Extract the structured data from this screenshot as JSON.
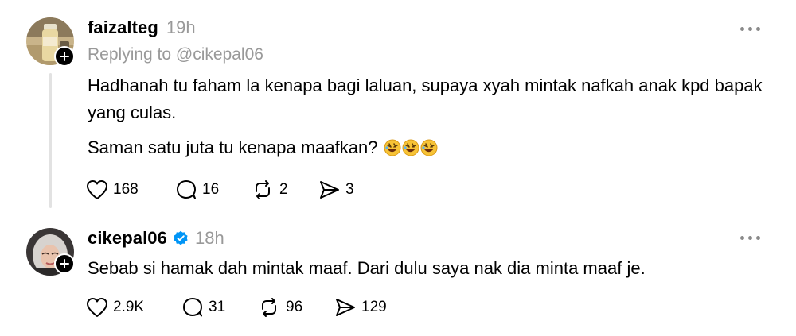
{
  "posts": [
    {
      "username": "faizalteg",
      "time": "19h",
      "replying_to": "Replying to @cikepal06",
      "paragraphs": [
        "Hadhanah tu faham la kenapa bagi laluan, supaya xyah mintak nafkah anak kpd bapak yang culas.",
        "Saman satu juta tu kenapa maafkan?"
      ],
      "emoji_name": "rolling-on-floor-laughing-emoji",
      "emoji_count": 3,
      "likes": "168",
      "replies": "16",
      "reposts": "2",
      "shares": "3",
      "avatar_icon": "avatar-bottle-photo"
    },
    {
      "username": "cikepal06",
      "verified": true,
      "time": "18h",
      "paragraphs": [
        "Sebab si hamak dah mintak maaf. Dari dulu saya nak dia minta maaf je."
      ],
      "likes": "2.9K",
      "replies": "31",
      "reposts": "96",
      "shares": "129",
      "avatar_icon": "avatar-woman-hijab-photo"
    }
  ],
  "colors": {
    "text": "#000000",
    "muted": "#999999",
    "verified": "#0095f6",
    "thread_line": "#e2e2e2"
  }
}
